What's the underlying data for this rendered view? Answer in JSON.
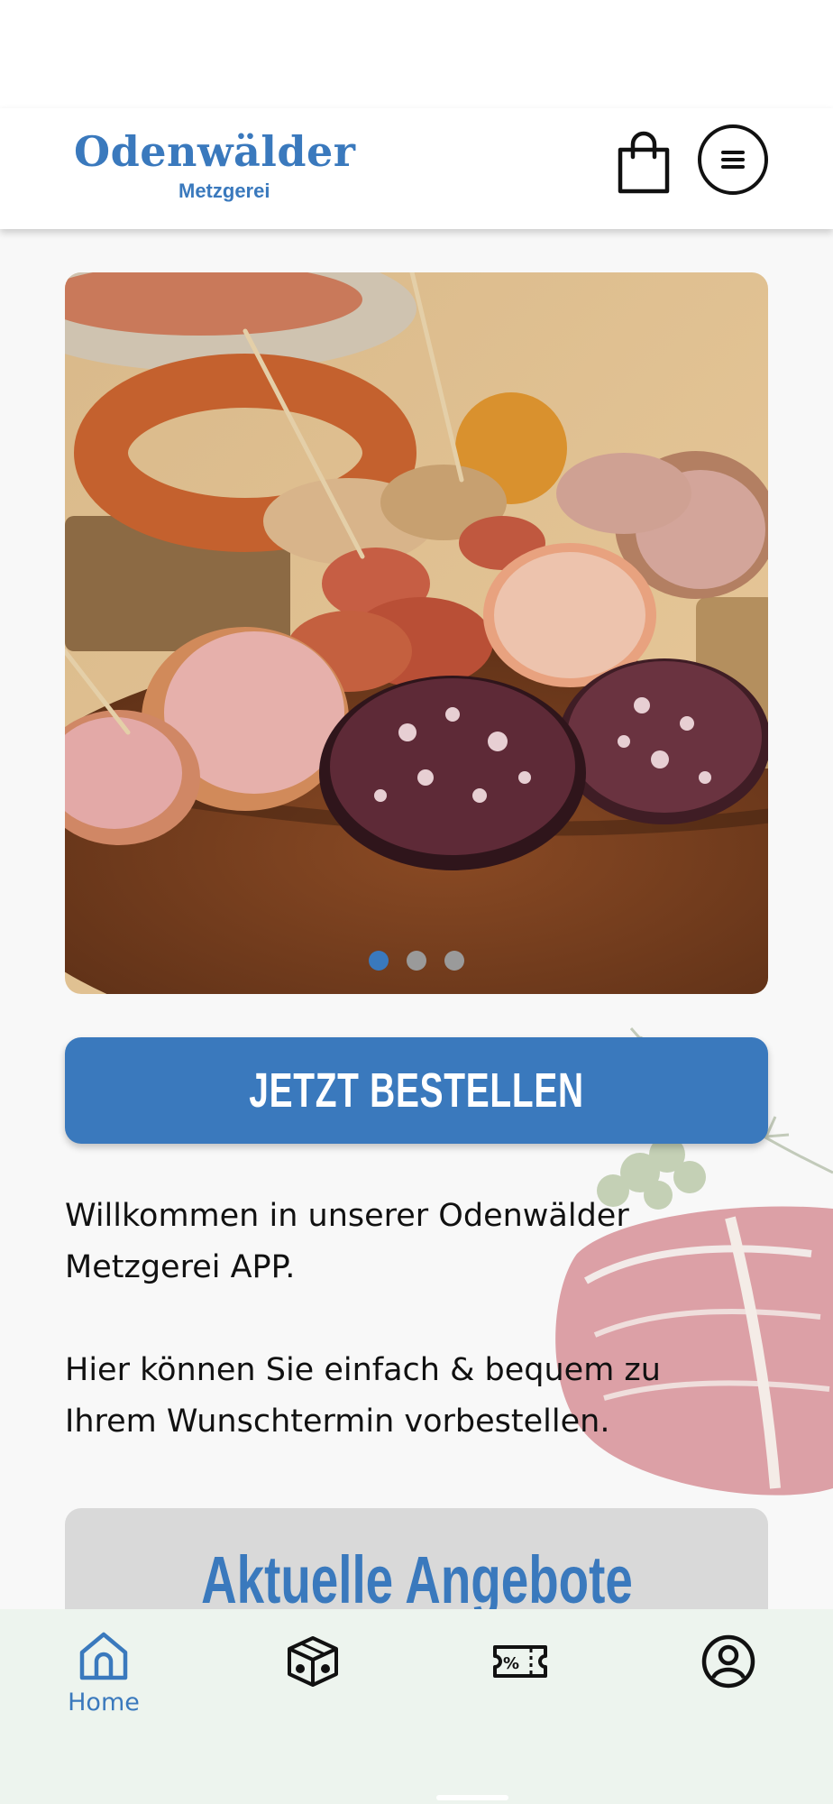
{
  "header": {
    "logo_main": "Odenwälder",
    "logo_sub": "Metzgerei",
    "cart_icon": "shopping-bag-icon",
    "menu_icon": "hamburger-menu-icon"
  },
  "carousel": {
    "slide_count": 3,
    "active_index": 0,
    "image_subject": "sausage-platter-photo"
  },
  "order_button": {
    "label": "JETZT BESTELLEN"
  },
  "welcome": {
    "line1": "Willkommen in unserer Odenwälder Metzgerei APP.",
    "line2": "Hier können Sie einfach & bequem zu Ihrem Wunschtermin vorbestellen."
  },
  "offers": {
    "title": "Aktuelle Angebote"
  },
  "tabbar": {
    "items": [
      {
        "label": "Home",
        "icon": "home-icon",
        "active": true
      },
      {
        "label": "",
        "icon": "product-box-icon",
        "active": false
      },
      {
        "label": "",
        "icon": "discount-ticket-icon",
        "active": false
      },
      {
        "label": "",
        "icon": "user-profile-icon",
        "active": false
      }
    ]
  },
  "colors": {
    "brand_blue": "#3a79bd",
    "tabbar_bg": "#edf4ee",
    "offers_card_bg": "#d9d9d9",
    "page_bg": "#f8f8f8"
  }
}
